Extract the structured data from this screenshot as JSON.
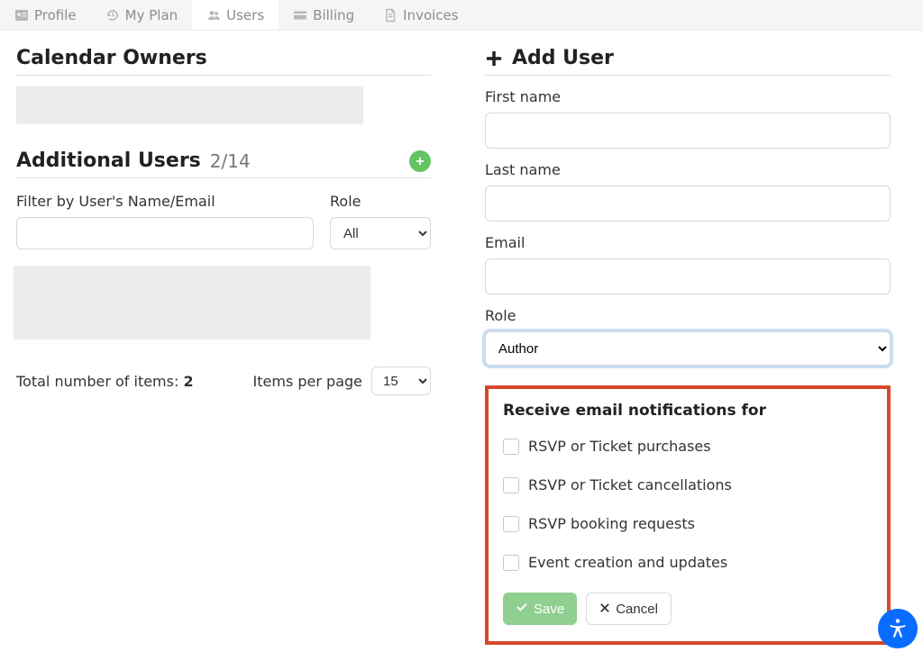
{
  "tabs": [
    {
      "label": "Profile"
    },
    {
      "label": "My Plan"
    },
    {
      "label": "Users"
    },
    {
      "label": "Billing"
    },
    {
      "label": "Invoices"
    }
  ],
  "left": {
    "calendar_owners_title": "Calendar Owners",
    "additional_users_title": "Additional Users",
    "additional_users_count": "2/14",
    "filter_label": "Filter by User's Name/Email",
    "role_label": "Role",
    "role_value": "All",
    "totals_prefix": "Total number of items: ",
    "totals_value": "2",
    "per_page_label": "Items per page",
    "per_page_value": "15"
  },
  "right": {
    "add_user_title": "Add User",
    "first_name_label": "First name",
    "last_name_label": "Last name",
    "email_label": "Email",
    "role_label": "Role",
    "role_value": "Author",
    "notif_title": "Receive email notifications for",
    "notifs": [
      "RSVP or Ticket purchases",
      "RSVP or Ticket cancellations",
      "RSVP booking requests",
      "Event creation and updates"
    ],
    "save_label": "Save",
    "cancel_label": "Cancel"
  }
}
